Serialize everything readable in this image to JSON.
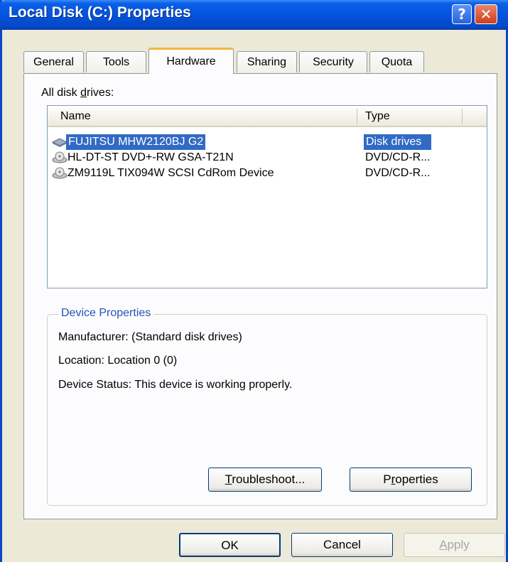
{
  "window": {
    "title": "Local Disk (C:) Properties",
    "help_glyph": "?",
    "close_glyph": "✕"
  },
  "tabs": [
    {
      "label": "General"
    },
    {
      "label": "Tools"
    },
    {
      "label": "Hardware",
      "active": true
    },
    {
      "label": "Sharing"
    },
    {
      "label": "Security"
    },
    {
      "label": "Quota"
    }
  ],
  "drives_label": {
    "pre": "All disk ",
    "accel": "d",
    "post": "rives:"
  },
  "list": {
    "columns": {
      "name": "Name",
      "type": "Type"
    },
    "rows": [
      {
        "name": "FUJITSU MHW2120BJ G2",
        "type": "Disk drives",
        "icon": "hard-disk-icon",
        "selected": true
      },
      {
        "name": "HL-DT-ST DVD+-RW GSA-T21N",
        "type": "DVD/CD-R...",
        "icon": "optical-drive-icon"
      },
      {
        "name": "ZM9119L TIX094W SCSI CdRom Device",
        "type": "DVD/CD-R...",
        "icon": "optical-drive-icon"
      }
    ]
  },
  "device_properties": {
    "title": "Device Properties",
    "manufacturer": "Manufacturer: (Standard disk drives)",
    "location": "Location: Location 0 (0)",
    "status": "Device Status: This device is working properly."
  },
  "buttons": {
    "troubleshoot": {
      "accel": "T",
      "rest": "roubleshoot..."
    },
    "properties": {
      "pre": "P",
      "accel": "r",
      "post": "operties"
    },
    "ok": "OK",
    "cancel": "Cancel",
    "apply": {
      "accel": "A",
      "rest": "pply"
    }
  }
}
